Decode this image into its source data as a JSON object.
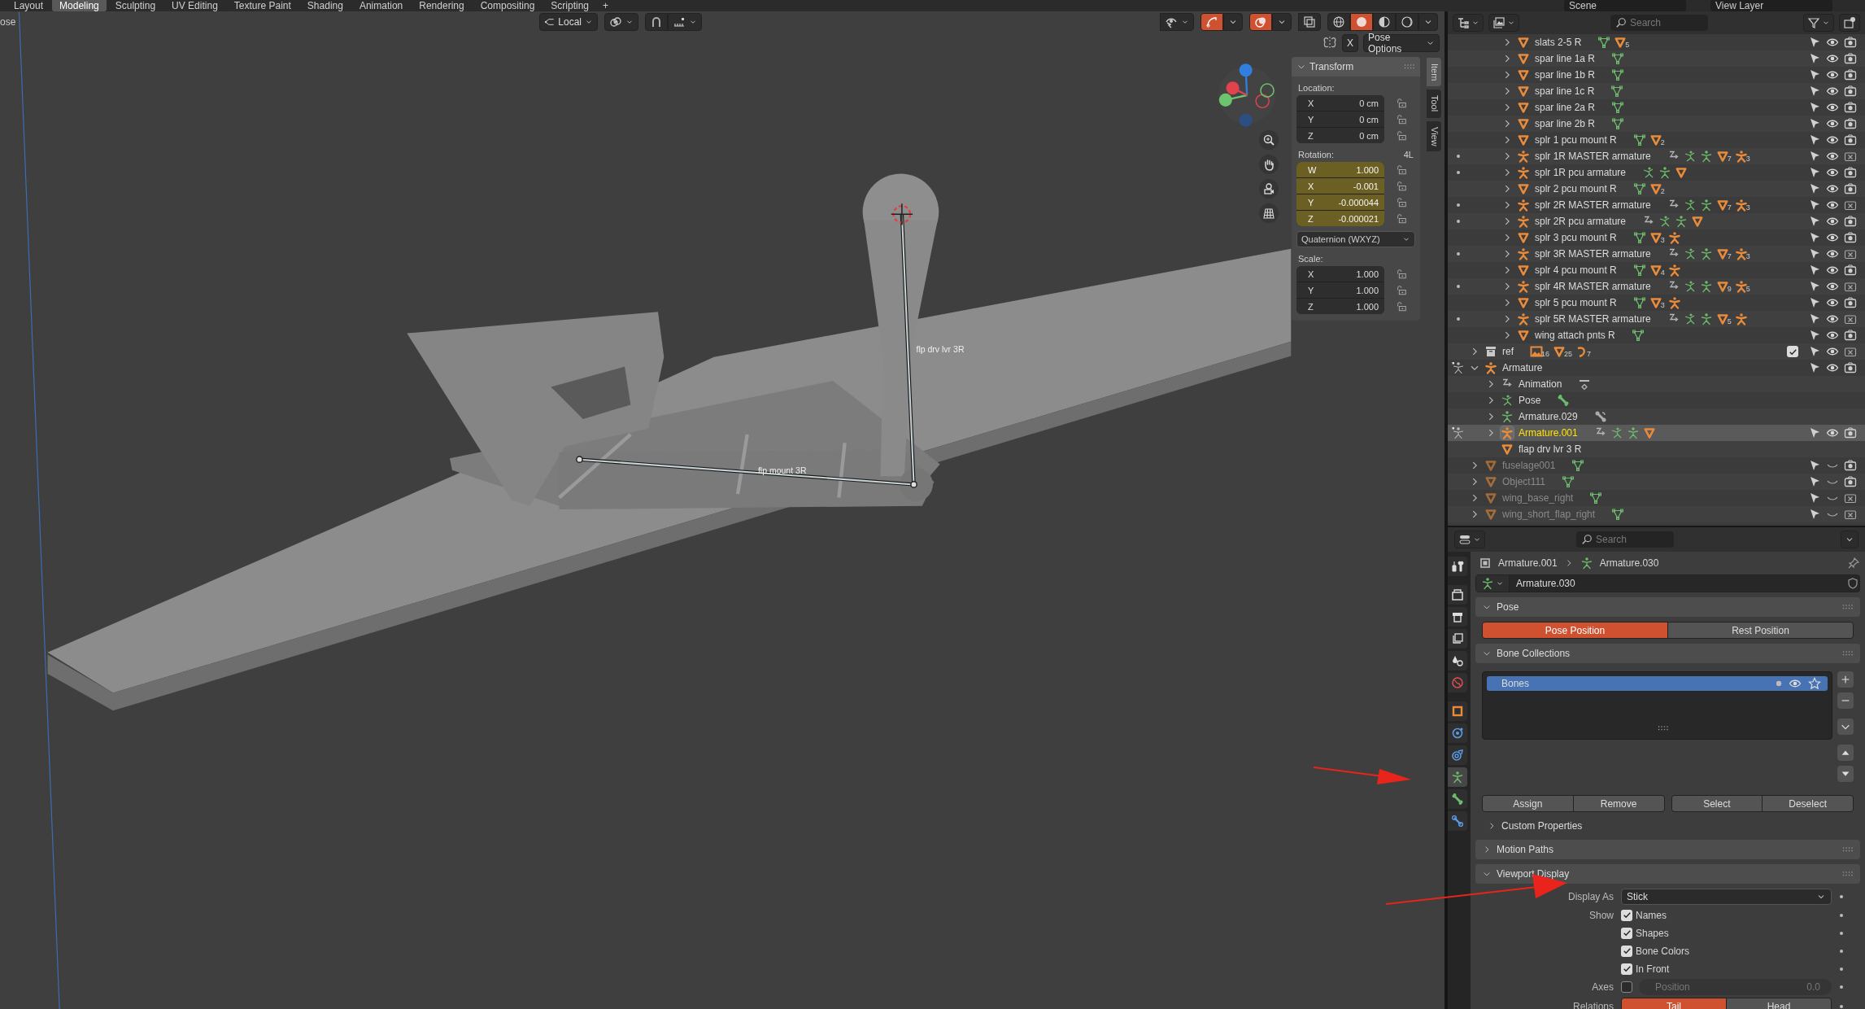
{
  "topbar": {
    "workspace_tabs": [
      {
        "label": "Layout",
        "selected": false
      },
      {
        "label": "Modeling",
        "selected": true
      },
      {
        "label": "Sculpting",
        "selected": false
      },
      {
        "label": "UV Editing",
        "selected": false
      },
      {
        "label": "Texture Paint",
        "selected": false
      },
      {
        "label": "Shading",
        "selected": false
      },
      {
        "label": "Animation",
        "selected": false
      },
      {
        "label": "Rendering",
        "selected": false
      },
      {
        "label": "Compositing",
        "selected": false
      },
      {
        "label": "Scripting",
        "selected": false
      }
    ],
    "add_tab": "+",
    "scene": "Scene",
    "view_layer": "View Layer"
  },
  "viewport": {
    "mode_menu": "ose",
    "orientation": "Local",
    "toggles": [
      {
        "kind": "visibility",
        "on": false
      },
      {
        "kind": "gizmo",
        "on": true
      },
      {
        "kind": "overlay",
        "on": true
      },
      {
        "kind": "xray",
        "on": false
      }
    ],
    "shading_modes": [
      {
        "kind": "wireframe",
        "selected": false
      },
      {
        "kind": "solid",
        "selected": true
      },
      {
        "kind": "material",
        "selected": false
      },
      {
        "kind": "rendered",
        "selected": false
      }
    ],
    "x_mirror": "X",
    "pose_options": "Pose Options",
    "bone_labels": [
      "flp drv lvr 3R",
      "flp mount 3R"
    ],
    "sidebar_tabs": [
      {
        "label": "Item",
        "selected": true
      },
      {
        "label": "Tool",
        "selected": false
      },
      {
        "label": "View",
        "selected": false
      }
    ],
    "transform": {
      "title": "Transform",
      "expanded": true,
      "groups": [
        {
          "label": "Location:",
          "animated": false,
          "fields": [
            {
              "axis": "X",
              "value": "0 cm"
            },
            {
              "axis": "Y",
              "value": "0 cm"
            },
            {
              "axis": "Z",
              "value": "0 cm"
            }
          ]
        },
        {
          "label": "Rotation:",
          "extra": "4L",
          "animated": true,
          "fields": [
            {
              "axis": "W",
              "value": "1.000"
            },
            {
              "axis": "X",
              "value": "-0.001"
            },
            {
              "axis": "Y",
              "value": "-0.000044"
            },
            {
              "axis": "Z",
              "value": "-0.000021"
            }
          ],
          "dropdown": "Quaternion (WXYZ)"
        },
        {
          "label": "Scale:",
          "animated": false,
          "fields": [
            {
              "axis": "X",
              "value": "1.000"
            },
            {
              "axis": "Y",
              "value": "1.000"
            },
            {
              "axis": "Z",
              "value": "1.000"
            }
          ]
        }
      ]
    }
  },
  "outliner": {
    "search_placeholder": "Search",
    "tree": [
      {
        "children": [
          {
            "children": [
              {
                "label": "slats 2-5 R",
                "kind": "mesh",
                "expanded": false,
                "badges": [
                  {
                    "kind": "meshdata"
                  },
                  {
                    "kind": "mesh",
                    "count": "5"
                  }
                ],
                "visible": true,
                "renderable": true,
                "selected": false
              },
              {
                "label": "spar line 1a R",
                "kind": "mesh",
                "expanded": false,
                "badges": [
                  {
                    "kind": "meshdata"
                  }
                ],
                "visible": true,
                "renderable": true,
                "selected": false
              },
              {
                "label": "spar line 1b R",
                "kind": "mesh",
                "expanded": false,
                "badges": [
                  {
                    "kind": "meshdata"
                  }
                ],
                "visible": true,
                "renderable": true,
                "selected": false
              },
              {
                "label": "spar line 1c R",
                "kind": "mesh",
                "expanded": false,
                "badges": [
                  {
                    "kind": "meshdata"
                  }
                ],
                "visible": true,
                "renderable": true,
                "selected": false
              },
              {
                "label": "spar line 2a R",
                "kind": "mesh",
                "expanded": false,
                "badges": [
                  {
                    "kind": "meshdata"
                  }
                ],
                "visible": true,
                "renderable": true,
                "selected": false
              },
              {
                "label": "spar line 2b R",
                "kind": "mesh",
                "expanded": false,
                "badges": [
                  {
                    "kind": "meshdata"
                  }
                ],
                "visible": true,
                "renderable": true,
                "selected": false
              },
              {
                "label": "splr 1 pcu mount R",
                "kind": "mesh",
                "expanded": false,
                "badges": [
                  {
                    "kind": "meshdata"
                  },
                  {
                    "kind": "mesh",
                    "count": "2"
                  }
                ],
                "visible": true,
                "renderable": true,
                "selected": false
              },
              {
                "label": "splr 1R MASTER armature",
                "kind": "armature",
                "mode": {
                  "kind": "dot"
                },
                "expanded": false,
                "badges": [
                  {
                    "kind": "action"
                  },
                  {
                    "kind": "pose"
                  },
                  {
                    "kind": "armdata"
                  },
                  {
                    "kind": "mesh",
                    "count": "7"
                  },
                  {
                    "kind": "armature",
                    "count": "3"
                  }
                ],
                "visible": true,
                "renderable": false,
                "selected": false
              },
              {
                "label": "splr 1R pcu armature",
                "kind": "armature",
                "mode": {
                  "kind": "dot"
                },
                "expanded": false,
                "badges": [
                  {
                    "kind": "pose"
                  },
                  {
                    "kind": "armdata"
                  },
                  {
                    "kind": "mesh"
                  }
                ],
                "visible": true,
                "renderable": true,
                "selected": false
              },
              {
                "label": "splr 2 pcu mount R",
                "kind": "mesh",
                "expanded": false,
                "badges": [
                  {
                    "kind": "meshdata"
                  },
                  {
                    "kind": "mesh",
                    "count": "2"
                  }
                ],
                "visible": true,
                "renderable": true,
                "selected": false
              },
              {
                "label": "splr 2R MASTER armature",
                "kind": "armature",
                "mode": {
                  "kind": "dot"
                },
                "expanded": false,
                "badges": [
                  {
                    "kind": "action"
                  },
                  {
                    "kind": "pose"
                  },
                  {
                    "kind": "armdata"
                  },
                  {
                    "kind": "mesh",
                    "count": "7"
                  },
                  {
                    "kind": "armature",
                    "count": "3"
                  }
                ],
                "visible": true,
                "renderable": false,
                "selected": false
              },
              {
                "label": "splr 2R pcu armature",
                "kind": "armature",
                "mode": {
                  "kind": "dot"
                },
                "expanded": false,
                "badges": [
                  {
                    "kind": "action"
                  },
                  {
                    "kind": "pose"
                  },
                  {
                    "kind": "armdata"
                  },
                  {
                    "kind": "mesh"
                  }
                ],
                "visible": true,
                "renderable": true,
                "selected": false
              },
              {
                "label": "splr 3 pcu mount R",
                "kind": "mesh",
                "expanded": false,
                "badges": [
                  {
                    "kind": "meshdata"
                  },
                  {
                    "kind": "mesh",
                    "count": "3"
                  },
                  {
                    "kind": "armature"
                  }
                ],
                "visible": true,
                "renderable": true,
                "selected": false
              },
              {
                "label": "splr 3R MASTER armature",
                "kind": "armature",
                "mode": {
                  "kind": "dot"
                },
                "expanded": false,
                "badges": [
                  {
                    "kind": "action"
                  },
                  {
                    "kind": "pose"
                  },
                  {
                    "kind": "armdata"
                  },
                  {
                    "kind": "mesh",
                    "count": "7"
                  },
                  {
                    "kind": "armature",
                    "count": "3"
                  }
                ],
                "visible": true,
                "renderable": false,
                "selected": false
              },
              {
                "label": "splr 4 pcu mount R",
                "kind": "mesh",
                "expanded": false,
                "badges": [
                  {
                    "kind": "meshdata"
                  },
                  {
                    "kind": "mesh",
                    "count": "4"
                  },
                  {
                    "kind": "armature"
                  }
                ],
                "visible": true,
                "renderable": true,
                "selected": false
              },
              {
                "label": "splr 4R MASTER armature",
                "kind": "armature",
                "mode": {
                  "kind": "dot"
                },
                "expanded": false,
                "badges": [
                  {
                    "kind": "action"
                  },
                  {
                    "kind": "pose"
                  },
                  {
                    "kind": "armdata"
                  },
                  {
                    "kind": "mesh",
                    "count": "9"
                  },
                  {
                    "kind": "armature",
                    "count": "5"
                  }
                ],
                "visible": true,
                "renderable": false,
                "selected": false
              },
              {
                "label": "splr 5 pcu mount R",
                "kind": "mesh",
                "expanded": false,
                "badges": [
                  {
                    "kind": "meshdata"
                  },
                  {
                    "kind": "mesh",
                    "count": "3"
                  },
                  {
                    "kind": "armature"
                  }
                ],
                "visible": true,
                "renderable": true,
                "selected": false
              },
              {
                "label": "splr 5R MASTER armature",
                "kind": "armature",
                "mode": {
                  "kind": "dot"
                },
                "expanded": false,
                "badges": [
                  {
                    "kind": "action"
                  },
                  {
                    "kind": "pose"
                  },
                  {
                    "kind": "armdata"
                  },
                  {
                    "kind": "mesh",
                    "count": "5"
                  },
                  {
                    "kind": "armature"
                  }
                ],
                "visible": true,
                "renderable": false,
                "selected": false
              },
              {
                "label": "wing attach pnts R",
                "kind": "mesh",
                "expanded": false,
                "badges": [
                  {
                    "kind": "meshdata"
                  }
                ],
                "visible": true,
                "renderable": true,
                "selected": false
              }
            ]
          }
        ]
      },
      {
        "label": "ref",
        "kind": "collection",
        "expanded": false,
        "badges": [
          {
            "kind": "image",
            "count": "16"
          },
          {
            "kind": "mesh",
            "count": "25"
          },
          {
            "kind": "curve",
            "count": "7"
          }
        ],
        "checked": true,
        "visible": true,
        "renderable": false,
        "selected": false
      },
      {
        "label": "Armature",
        "kind": "armature",
        "mode": {
          "kind": "pose"
        },
        "expanded": true,
        "visible": true,
        "renderable": true,
        "selected": false,
        "children": [
          {
            "label": "Animation",
            "kind": "action",
            "expanded": false,
            "badges": [
              {
                "kind": "keyframe"
              }
            ],
            "selected": false
          },
          {
            "label": "Pose",
            "kind": "pose",
            "expanded": false,
            "badges": [
              {
                "kind": "bone"
              }
            ],
            "selected": false
          },
          {
            "label": "Armature.029",
            "kind": "armdata",
            "expanded": false,
            "badges": [
              {
                "kind": "constraint"
              }
            ],
            "selected": false
          },
          {
            "label": "Armature.001",
            "kind": "armature",
            "mode": {
              "kind": "pose"
            },
            "expanded": false,
            "badges": [
              {
                "kind": "action"
              },
              {
                "kind": "pose"
              },
              {
                "kind": "armdata"
              },
              {
                "kind": "mesh"
              }
            ],
            "visible": true,
            "renderable": true,
            "selected": true
          },
          {
            "label": "flap drv lvr 3 R",
            "kind": "mesh",
            "selected": false
          }
        ]
      },
      {
        "label": "fuselage001",
        "kind": "mesh",
        "expanded": false,
        "badges": [
          {
            "kind": "meshdata"
          }
        ],
        "visible": false,
        "renderable": true,
        "selected": false
      },
      {
        "label": "Object111",
        "kind": "mesh",
        "expanded": false,
        "badges": [
          {
            "kind": "meshdata"
          }
        ],
        "visible": false,
        "renderable": true,
        "selected": false
      },
      {
        "label": "wing_base_right",
        "kind": "mesh",
        "expanded": false,
        "badges": [
          {
            "kind": "meshdata"
          }
        ],
        "visible": false,
        "renderable": false,
        "selected": false
      },
      {
        "label": "wing_short_flap_right",
        "kind": "mesh",
        "expanded": false,
        "badges": [
          {
            "kind": "meshdata"
          }
        ],
        "visible": false,
        "renderable": false,
        "selected": false
      }
    ]
  },
  "properties": {
    "search_placeholder": "Search",
    "tabs": [
      {
        "kind": "tool",
        "selected": false
      },
      {
        "kind": "render",
        "selected": false
      },
      {
        "kind": "output",
        "selected": false
      },
      {
        "kind": "view_layer",
        "selected": false
      },
      {
        "kind": "scene",
        "selected": false
      },
      {
        "kind": "world",
        "selected": false
      },
      {
        "kind": "object",
        "selected": false
      },
      {
        "kind": "physics",
        "selected": false
      },
      {
        "kind": "constraints",
        "selected": false
      },
      {
        "kind": "data",
        "selected": true
      },
      {
        "kind": "bone",
        "selected": false
      },
      {
        "kind": "bone_constraints",
        "selected": false
      }
    ],
    "breadcrumb": [
      "Armature.001",
      "Armature.030"
    ],
    "datablock": "Armature.030",
    "panels": [
      {
        "kind": "pose",
        "title": "Pose",
        "expanded": true,
        "options": [
          {
            "label": "Pose Position",
            "selected": true
          },
          {
            "label": "Rest Position",
            "selected": false
          }
        ]
      },
      {
        "kind": "bone_collections",
        "title": "Bone Collections",
        "expanded": true,
        "collections": [
          {
            "label": "Bones",
            "selected": true
          }
        ],
        "buttons": [
          [
            "Assign",
            "Remove"
          ],
          [
            "Select",
            "Deselect"
          ]
        ],
        "subpanels": [
          {
            "title": "Custom Properties",
            "expanded": false
          }
        ]
      },
      {
        "kind": "plain",
        "title": "Motion Paths",
        "expanded": false
      },
      {
        "kind": "viewport_display",
        "title": "Viewport Display",
        "expanded": true,
        "display_as_label": "Display As",
        "display_as": "Stick",
        "show_label": "Show",
        "show": [
          {
            "label": "Names",
            "checked": true
          },
          {
            "label": "Shapes",
            "checked": true
          },
          {
            "label": "Bone Colors",
            "checked": true
          },
          {
            "label": "In Front",
            "checked": true
          }
        ],
        "axes_label": "Axes",
        "axes": {
          "checked": false,
          "field_label": "Position",
          "field_value": "0.0"
        },
        "relations_label": "Relations",
        "relations": [
          {
            "label": "Tail",
            "selected": true
          },
          {
            "label": "Head",
            "selected": false
          }
        ]
      }
    ]
  }
}
